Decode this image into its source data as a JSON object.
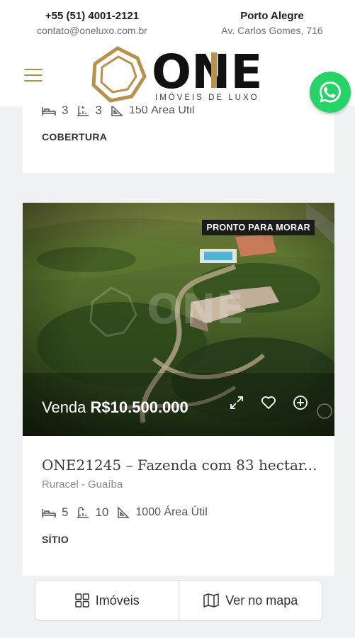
{
  "header": {
    "phone": "+55 (51) 4001-2121",
    "email": "contato@oneluxo.com.br",
    "city": "Porto Alegre",
    "address": "Av. Carlos Gomes, 716",
    "logo_text": "ONE",
    "logo_tagline": "IMÓVEIS DE LUXO",
    "logo_color": "#b8924d"
  },
  "card1": {
    "bedrooms": "3",
    "bathrooms": "3",
    "area": "150 Área Útil",
    "type": "COBERTURA"
  },
  "card2": {
    "badge": "PRONTO PARA MORAR",
    "price_prefix": "Venda",
    "price": "R$10.500.000",
    "title": "ONE21245 – Fazenda com 83 hectar...",
    "location": "Ruracel - Guaíba",
    "bedrooms": "5",
    "bathrooms": "10",
    "area": "1000 Área Útil",
    "type": "SÍTIO"
  },
  "bottom_nav": {
    "properties_label": "Imóveis",
    "map_label": "Ver no mapa"
  },
  "colors": {
    "accent": "#b58e4a",
    "whatsapp": "#25d366"
  }
}
